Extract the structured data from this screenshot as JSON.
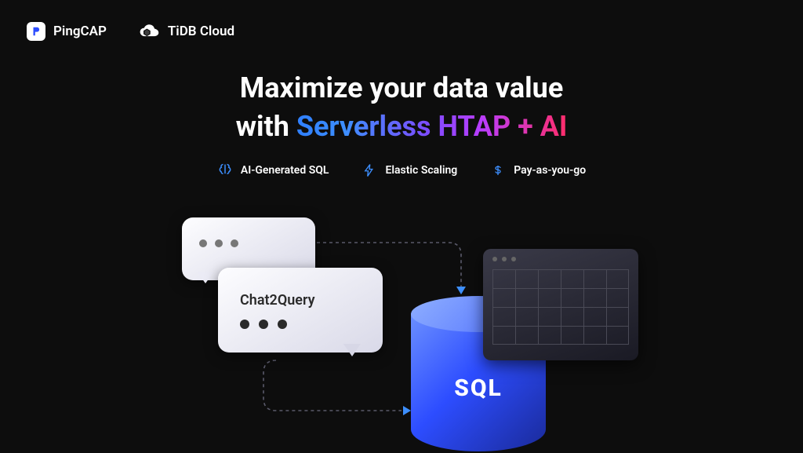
{
  "header": {
    "brand1": "PingCAP",
    "brand2": "TiDB Cloud"
  },
  "headline": {
    "line1": "Maximize your data value",
    "line2_prefix": "with ",
    "line2_gradient": "Serverless HTAP + AI"
  },
  "features": {
    "f1": "AI-Generated SQL",
    "f2": "Elastic Scaling",
    "f3": "Pay-as-you-go"
  },
  "diagram": {
    "chat_label": "Chat2Query",
    "db_label": "SQL"
  }
}
